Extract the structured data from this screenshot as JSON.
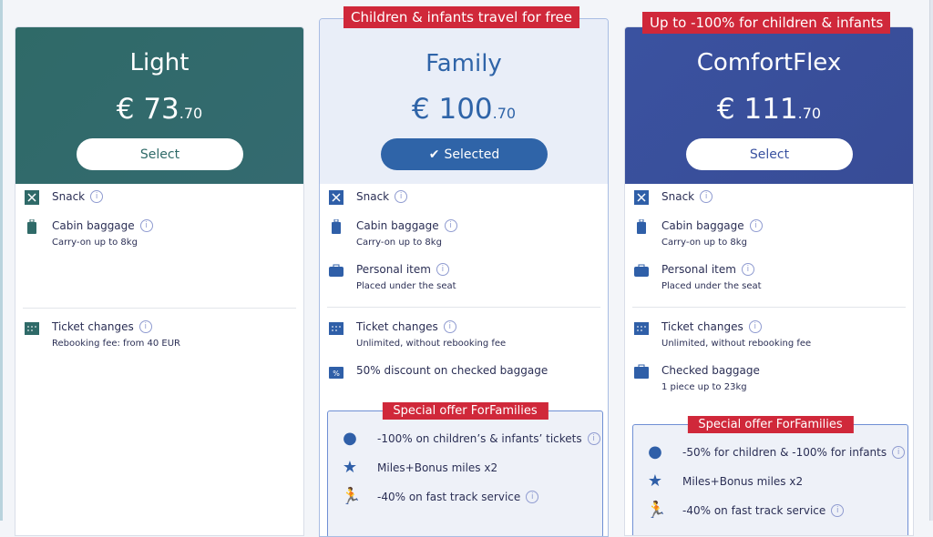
{
  "colors": {
    "light": "#2f6a68",
    "family_accent": "#2f64a8",
    "comfort": "#3a52a0",
    "badge_red": "#d0283a"
  },
  "cards": [
    {
      "name": "Light",
      "price_main": "€ 73",
      "price_cents": ".70",
      "button": "Select",
      "selected": false,
      "features": [
        {
          "label": "Snack",
          "icon": "snack-icon"
        },
        {
          "label": "Cabin baggage",
          "sub": "Carry-on up to 8kg",
          "icon": "luggage-icon"
        },
        {
          "label": "Ticket changes",
          "sub": "Rebooking fee: from 40 EUR",
          "icon": "calendar-icon"
        }
      ]
    },
    {
      "name": "Family",
      "badge": "Children & infants travel for free",
      "price_main": "€ 100",
      "price_cents": ".70",
      "button": "Selected",
      "selected": true,
      "features": [
        {
          "label": "Snack"
        },
        {
          "label": "Cabin baggage",
          "sub": "Carry-on up to 8kg"
        },
        {
          "label": "Personal item",
          "sub": "Placed under the seat"
        },
        {
          "label": "Ticket changes",
          "sub": "Unlimited, without rebooking fee"
        },
        {
          "label": "50% discount on checked baggage"
        }
      ],
      "offer": {
        "title": "Special offer ForFamilies",
        "items": [
          "-100% on children’s & infants’ tickets",
          "Miles+Bonus miles x2",
          "-40% on fast track service"
        ]
      }
    },
    {
      "name": "ComfortFlex",
      "badge": "Up to -100% for children & infants",
      "price_main": "€ 111",
      "price_cents": ".70",
      "button": "Select",
      "selected": false,
      "features": [
        {
          "label": "Snack"
        },
        {
          "label": "Cabin baggage",
          "sub": "Carry-on up to 8kg"
        },
        {
          "label": "Personal item",
          "sub": "Placed under the seat"
        },
        {
          "label": "Ticket changes",
          "sub": "Unlimited, without rebooking fee"
        },
        {
          "label": "Checked baggage",
          "sub": "1 piece up to 23kg"
        }
      ],
      "offer": {
        "title": "Special offer ForFamilies",
        "items": [
          "-50% for children & -100% for infants",
          "Miles+Bonus miles x2",
          "-40% on fast track service"
        ]
      }
    }
  ]
}
